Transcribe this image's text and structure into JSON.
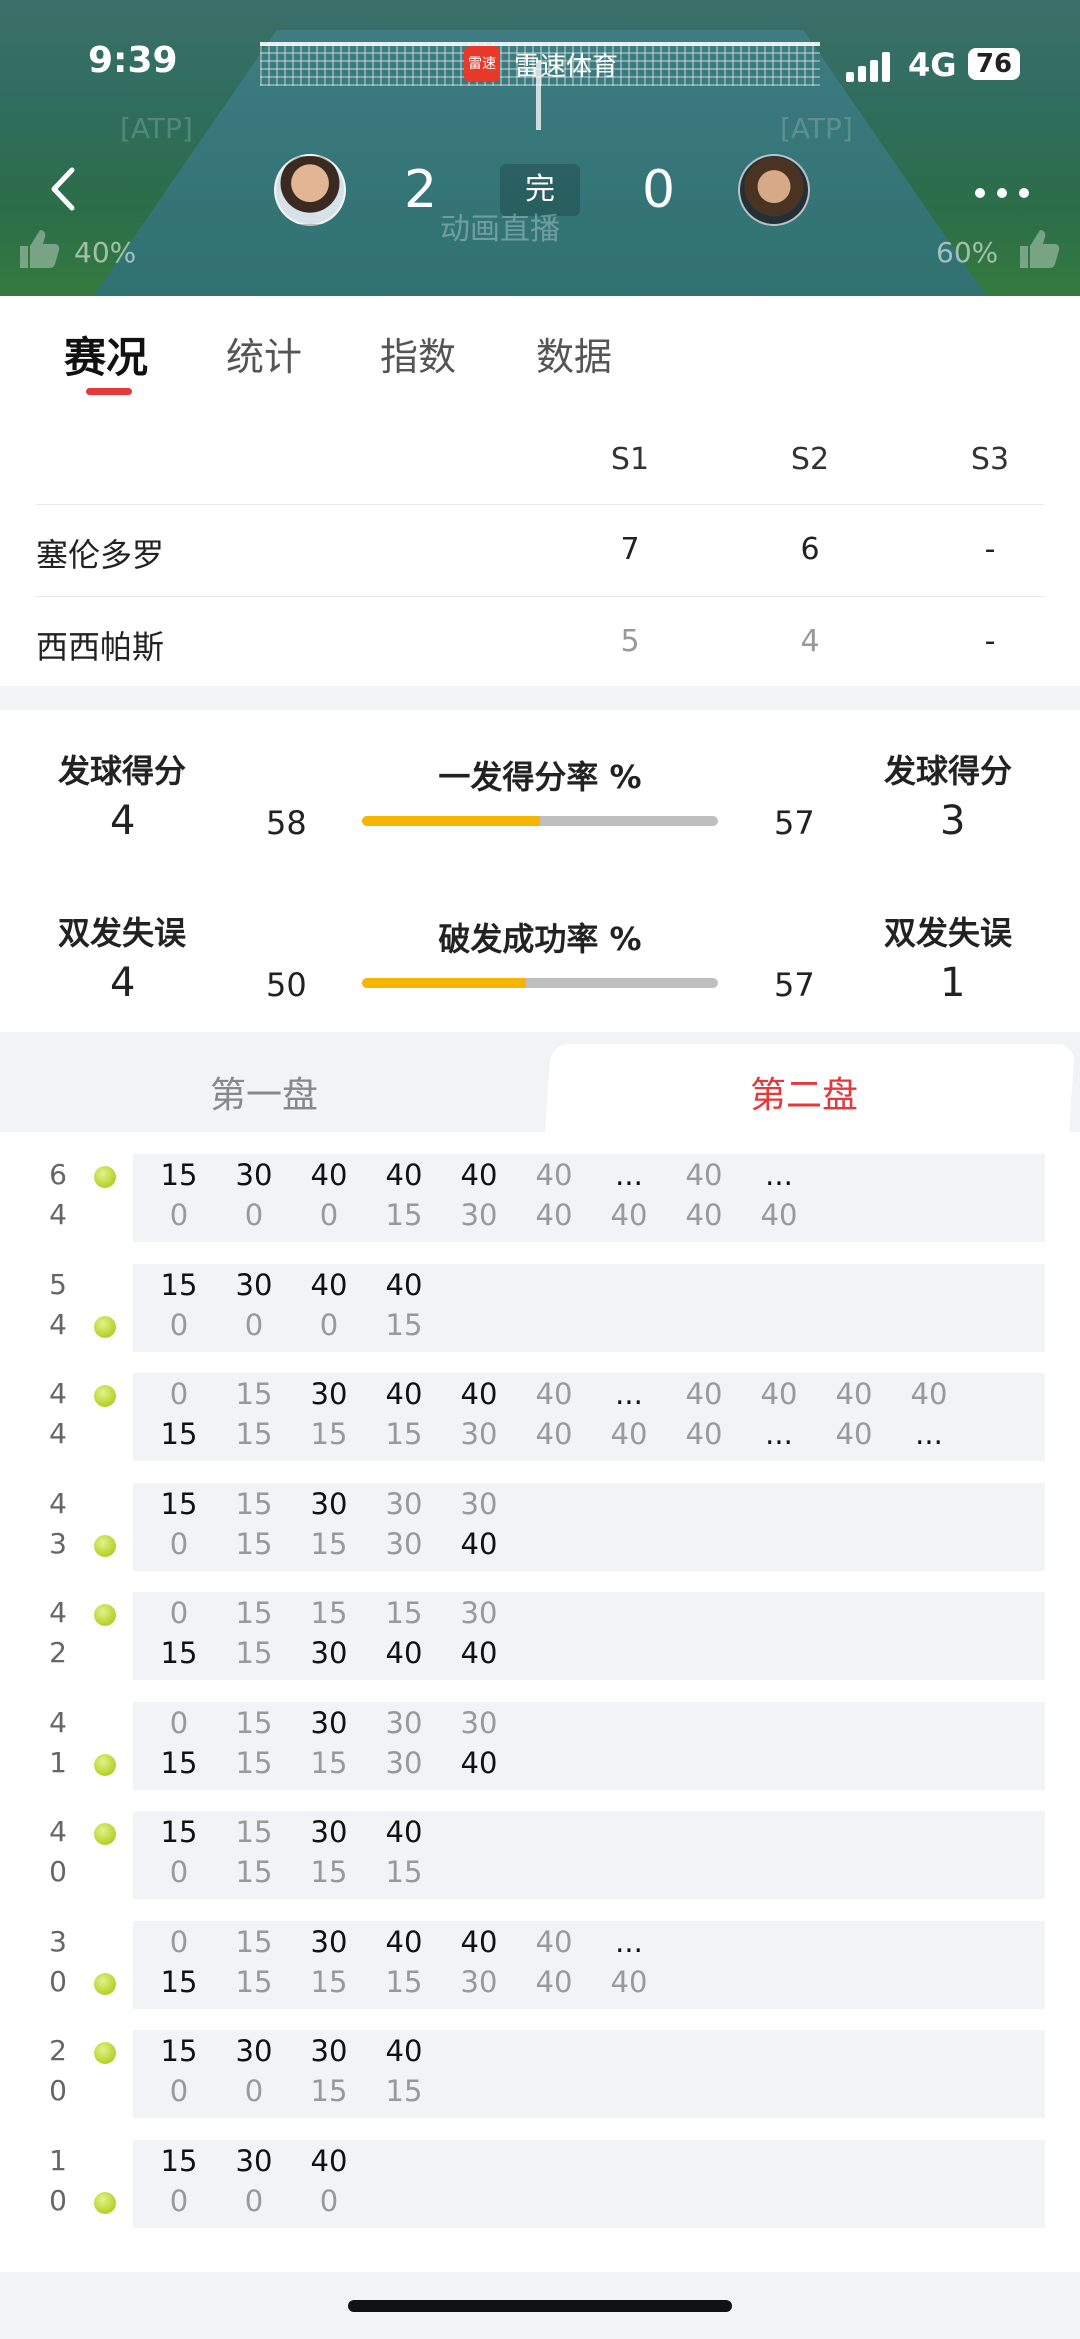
{
  "status": {
    "time": "9:39",
    "network": "4G",
    "battery": "76"
  },
  "app": {
    "badge": "雷速",
    "name": "雷速体育"
  },
  "match": {
    "home_sets": "2",
    "away_sets": "0",
    "state": "完",
    "home_like_pct": "40%",
    "away_like_pct": "60%",
    "live_text": "动画直播"
  },
  "tabs": [
    "赛况",
    "统计",
    "指数",
    "数据"
  ],
  "sets_table": {
    "headers": [
      "S1",
      "S2",
      "S3"
    ],
    "rows": [
      {
        "name": "塞伦多罗",
        "scores": [
          "7",
          "6",
          "-"
        ]
      },
      {
        "name": "西西帕斯",
        "scores": [
          "5",
          "4",
          "-"
        ]
      }
    ]
  },
  "stats": {
    "row1": {
      "left_label": "发球得分",
      "left_value": "4",
      "center_title": "一发得分率 %",
      "left_pct": "58",
      "right_pct": "57",
      "fill": 0.5,
      "right_label": "发球得分",
      "right_value": "3"
    },
    "row2": {
      "left_label": "双发失误",
      "left_value": "4",
      "center_title": "破发成功率 %",
      "left_pct": "50",
      "right_pct": "57",
      "fill": 0.46,
      "right_label": "双发失误",
      "right_value": "1"
    }
  },
  "set_tabs": {
    "first": "第一盘",
    "second": "第二盘"
  },
  "games": [
    {
      "home": "6",
      "away": "4",
      "server": "home",
      "top": [
        "15",
        "30",
        "40",
        "40",
        "40",
        "40",
        "...",
        "40",
        "..."
      ],
      "bottom": [
        "0",
        "0",
        "0",
        "15",
        "30",
        "40",
        "40",
        "40",
        "40"
      ],
      "topBold": [
        1,
        1,
        1,
        1,
        1,
        0,
        1,
        0,
        1
      ],
      "botBold": [
        0,
        0,
        0,
        0,
        0,
        0,
        0,
        0,
        0
      ]
    },
    {
      "home": "5",
      "away": "4",
      "server": "away",
      "top": [
        "15",
        "30",
        "40",
        "40"
      ],
      "bottom": [
        "0",
        "0",
        "0",
        "15"
      ],
      "topBold": [
        1,
        1,
        1,
        1
      ],
      "botBold": [
        0,
        0,
        0,
        0
      ]
    },
    {
      "home": "4",
      "away": "4",
      "server": "home",
      "top": [
        "0",
        "15",
        "30",
        "40",
        "40",
        "40",
        "...",
        "40",
        "40",
        "40",
        "40"
      ],
      "bottom": [
        "15",
        "15",
        "15",
        "15",
        "30",
        "40",
        "40",
        "40",
        "...",
        "40",
        "..."
      ],
      "topBold": [
        0,
        0,
        1,
        1,
        1,
        0,
        1,
        0,
        0,
        0,
        0
      ],
      "botBold": [
        1,
        0,
        0,
        0,
        0,
        0,
        0,
        0,
        1,
        0,
        1
      ]
    },
    {
      "home": "4",
      "away": "3",
      "server": "away",
      "top": [
        "15",
        "15",
        "30",
        "30",
        "30"
      ],
      "bottom": [
        "0",
        "15",
        "15",
        "30",
        "40"
      ],
      "topBold": [
        1,
        0,
        1,
        0,
        0
      ],
      "botBold": [
        0,
        0,
        0,
        0,
        1
      ]
    },
    {
      "home": "4",
      "away": "2",
      "server": "home",
      "top": [
        "0",
        "15",
        "15",
        "15",
        "30"
      ],
      "bottom": [
        "15",
        "15",
        "30",
        "40",
        "40"
      ],
      "topBold": [
        0,
        0,
        0,
        0,
        0
      ],
      "botBold": [
        1,
        0,
        1,
        1,
        1
      ]
    },
    {
      "home": "4",
      "away": "1",
      "server": "away",
      "top": [
        "0",
        "15",
        "30",
        "30",
        "30"
      ],
      "bottom": [
        "15",
        "15",
        "15",
        "30",
        "40"
      ],
      "topBold": [
        0,
        0,
        1,
        0,
        0
      ],
      "botBold": [
        1,
        0,
        0,
        0,
        1
      ]
    },
    {
      "home": "4",
      "away": "0",
      "server": "home",
      "top": [
        "15",
        "15",
        "30",
        "40"
      ],
      "bottom": [
        "0",
        "15",
        "15",
        "15"
      ],
      "topBold": [
        1,
        0,
        1,
        1
      ],
      "botBold": [
        0,
        0,
        0,
        0
      ]
    },
    {
      "home": "3",
      "away": "0",
      "server": "away",
      "top": [
        "0",
        "15",
        "30",
        "40",
        "40",
        "40",
        "..."
      ],
      "bottom": [
        "15",
        "15",
        "15",
        "15",
        "30",
        "40",
        "40"
      ],
      "topBold": [
        0,
        0,
        1,
        1,
        1,
        0,
        1
      ],
      "botBold": [
        1,
        0,
        0,
        0,
        0,
        0,
        0
      ]
    },
    {
      "home": "2",
      "away": "0",
      "server": "home",
      "top": [
        "15",
        "30",
        "30",
        "40"
      ],
      "bottom": [
        "0",
        "0",
        "15",
        "15"
      ],
      "topBold": [
        1,
        1,
        1,
        1
      ],
      "botBold": [
        0,
        0,
        0,
        0
      ]
    },
    {
      "home": "1",
      "away": "0",
      "server": "away",
      "top": [
        "15",
        "30",
        "40"
      ],
      "bottom": [
        "0",
        "0",
        "0"
      ],
      "topBold": [
        1,
        1,
        1
      ],
      "botBold": [
        0,
        0,
        0
      ]
    }
  ]
}
